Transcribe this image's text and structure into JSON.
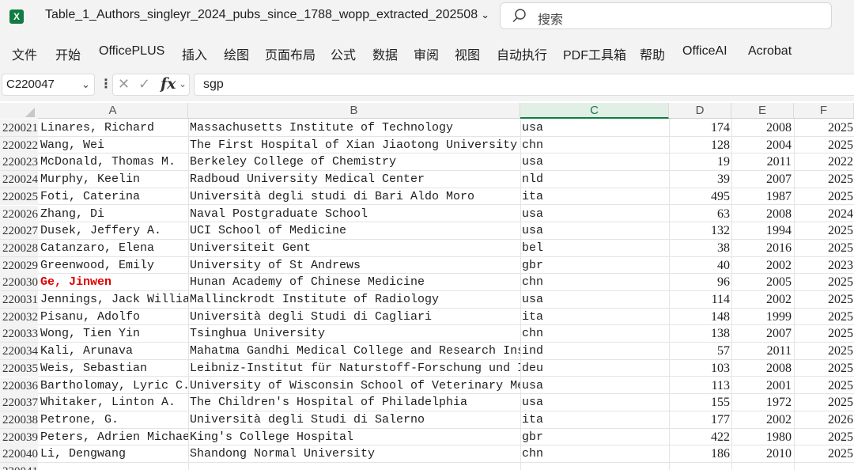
{
  "window": {
    "title": "Table_1_Authors_singleyr_2024_pubs_since_1788_wopp_extracted_202508",
    "app_icon": "excel-icon",
    "search_placeholder": "搜索"
  },
  "menu": [
    "文件",
    "开始",
    "OfficePLUS",
    "插入",
    "绘图",
    "页面布局",
    "公式",
    "数据",
    "审阅",
    "视图",
    "自动执行",
    "PDF工具箱",
    "帮助",
    "OfficeAI",
    "Acrobat"
  ],
  "formula_bar": {
    "name_box": "C220047",
    "fx_label": "fx",
    "formula": "sgp"
  },
  "columns": [
    "A",
    "B",
    "C",
    "D",
    "E",
    "F"
  ],
  "selected_column": "C",
  "rows": [
    {
      "num": "220021",
      "a": "Linares, Richard",
      "b": "Massachusetts Institute of Technology",
      "c": "usa",
      "d": "174",
      "e": "2008",
      "f": "2025"
    },
    {
      "num": "220022",
      "a": "Wang, Wei",
      "b": "The First Hospital of Xian Jiaotong University",
      "c": "chn",
      "d": "128",
      "e": "2004",
      "f": "2025"
    },
    {
      "num": "220023",
      "a": "McDonald, Thomas M.",
      "b": "Berkeley College of Chemistry",
      "c": "usa",
      "d": "19",
      "e": "2011",
      "f": "2022"
    },
    {
      "num": "220024",
      "a": "Murphy, Keelin",
      "b": "Radboud University Medical Center",
      "c": "nld",
      "d": "39",
      "e": "2007",
      "f": "2025"
    },
    {
      "num": "220025",
      "a": "Foti, Caterina",
      "b": "Università degli studi di Bari Aldo Moro",
      "c": "ita",
      "d": "495",
      "e": "1987",
      "f": "2025"
    },
    {
      "num": "220026",
      "a": "Zhang, Di",
      "b": "Naval Postgraduate School",
      "c": "usa",
      "d": "63",
      "e": "2008",
      "f": "2024"
    },
    {
      "num": "220027",
      "a": "Dusek, Jeffery A.",
      "b": "UCI School of Medicine",
      "c": "usa",
      "d": "132",
      "e": "1994",
      "f": "2025"
    },
    {
      "num": "220028",
      "a": "Catanzaro, Elena",
      "b": "Universiteit Gent",
      "c": "bel",
      "d": "38",
      "e": "2016",
      "f": "2025"
    },
    {
      "num": "220029",
      "a": "Greenwood, Emily",
      "b": "University of St Andrews",
      "c": "gbr",
      "d": "40",
      "e": "2002",
      "f": "2023"
    },
    {
      "num": "220030",
      "a": "Ge, Jinwen",
      "b": "Hunan Academy of Chinese Medicine",
      "c": "chn",
      "d": "96",
      "e": "2005",
      "f": "2025",
      "highlight": true
    },
    {
      "num": "220031",
      "a": "Jennings, Jack William",
      "b": "Mallinckrodt Institute of Radiology",
      "c": "usa",
      "d": "114",
      "e": "2002",
      "f": "2025"
    },
    {
      "num": "220032",
      "a": "Pisanu, Adolfo",
      "b": "Università degli Studi di Cagliari",
      "c": "ita",
      "d": "148",
      "e": "1999",
      "f": "2025"
    },
    {
      "num": "220033",
      "a": "Wong, Tien Yin",
      "b": "Tsinghua University",
      "c": "chn",
      "d": "138",
      "e": "2007",
      "f": "2025"
    },
    {
      "num": "220034",
      "a": "Kali, Arunava",
      "b": "Mahatma Gandhi Medical College and Research Institute",
      "c": "ind",
      "d": "57",
      "e": "2011",
      "f": "2025"
    },
    {
      "num": "220035",
      "a": "Weis, Sebastian",
      "b": "Leibniz-Institut für Naturstoff-Forschung und Infektionsbiologie",
      "c": "deu",
      "d": "103",
      "e": "2008",
      "f": "2025"
    },
    {
      "num": "220036",
      "a": "Bartholomay, Lyric C.",
      "b": "University of Wisconsin School of Veterinary Medicine",
      "c": "usa",
      "d": "113",
      "e": "2001",
      "f": "2025"
    },
    {
      "num": "220037",
      "a": "Whitaker, Linton A.",
      "b": "The Children's Hospital of Philadelphia",
      "c": "usa",
      "d": "155",
      "e": "1972",
      "f": "2025"
    },
    {
      "num": "220038",
      "a": "Petrone, G.",
      "b": "Università degli Studi di Salerno",
      "c": "ita",
      "d": "177",
      "e": "2002",
      "f": "2026"
    },
    {
      "num": "220039",
      "a": "Peters, Adrien Michael",
      "b": "King's College Hospital",
      "c": "gbr",
      "d": "422",
      "e": "1980",
      "f": "2025"
    },
    {
      "num": "220040",
      "a": "Li, Dengwang",
      "b": "Shandong Normal University",
      "c": "chn",
      "d": "186",
      "e": "2010",
      "f": "2025"
    },
    {
      "num": "220041",
      "a": "",
      "b": "",
      "c": "",
      "d": "",
      "e": "",
      "f": ""
    }
  ]
}
